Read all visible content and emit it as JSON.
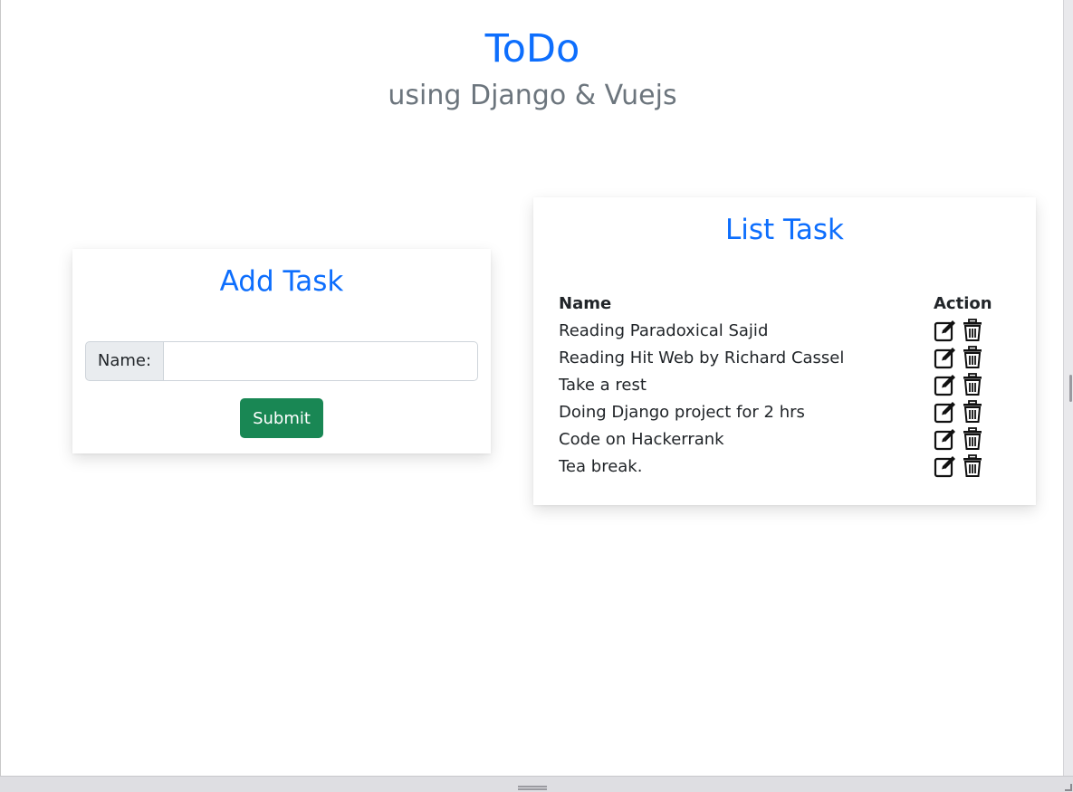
{
  "header": {
    "title": "ToDo",
    "subtitle": "using Django & Vuejs"
  },
  "add_task": {
    "title": "Add Task",
    "name_label": "Name:",
    "name_value": "",
    "submit_label": "Submit"
  },
  "list_task": {
    "title": "List Task",
    "columns": [
      "Name",
      "Action"
    ],
    "rows": [
      {
        "name": "Reading Paradoxical Sajid"
      },
      {
        "name": "Reading Hit Web by Richard Cassel"
      },
      {
        "name": "Take a rest"
      },
      {
        "name": "Doing Django project for 2 hrs"
      },
      {
        "name": "Code on Hackerrank"
      },
      {
        "name": "Tea break."
      }
    ],
    "row_actions": [
      "edit-icon",
      "trash-icon"
    ]
  },
  "colors": {
    "primary": "#0d6efd",
    "muted": "#6c757d",
    "success": "#198754"
  }
}
